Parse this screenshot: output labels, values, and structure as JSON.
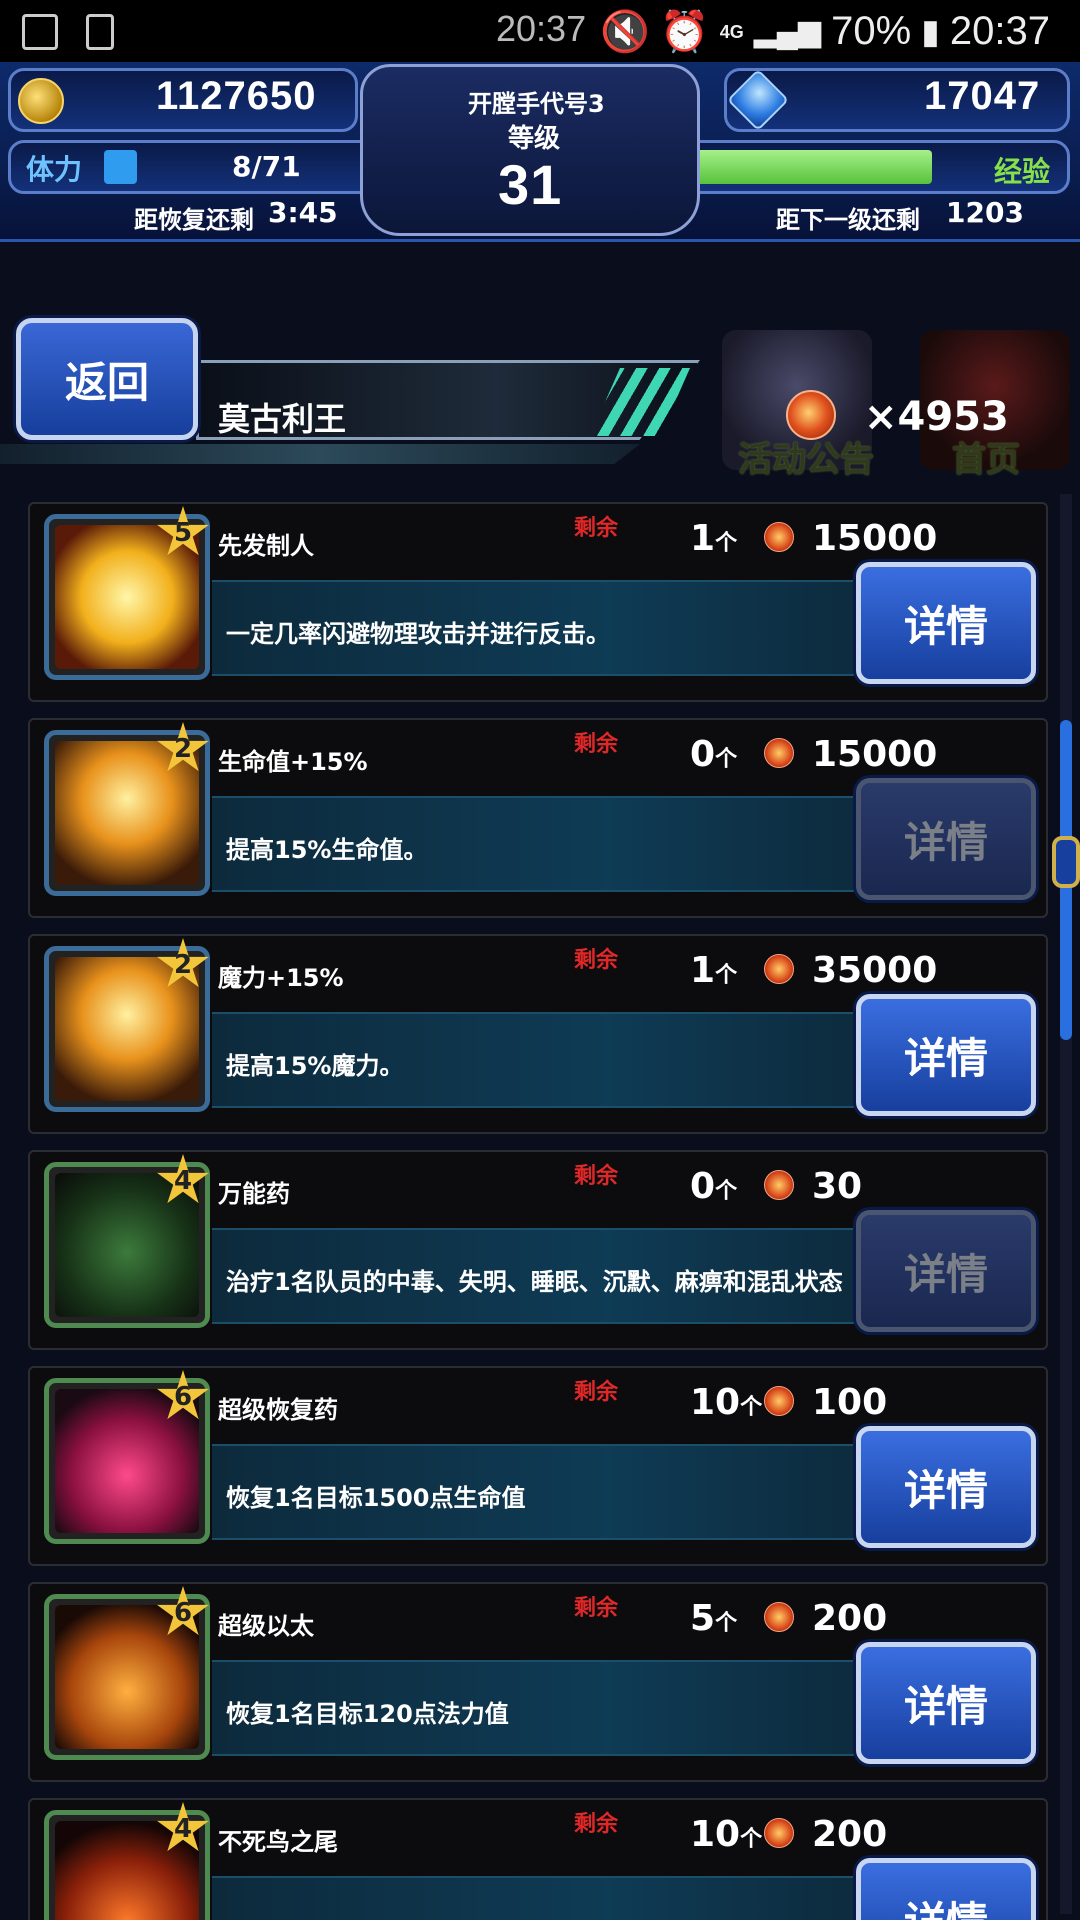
{
  "status_bar": {
    "time_center": "20:37",
    "network": "4G",
    "battery": "70%",
    "time_right": "20:37"
  },
  "hud": {
    "gil": "1127650",
    "player_name": "开膛手代号3",
    "level_label": "等级",
    "level": "31",
    "gems": "17047",
    "stamina_label": "体力",
    "stamina_value": "8/71",
    "recover_label": "距恢复还剩",
    "recover_time": "3:45",
    "exp_label": "经验",
    "next_level_label": "距下一级还剩",
    "next_level_value": "1203",
    "stamina_fill_fraction": 0.11,
    "exp_fill_fraction": 0.86
  },
  "header": {
    "back_label": "返回",
    "shop_title": "莫古利王",
    "events_label": "活动公告",
    "home_label": "首页",
    "currency_count": "×4953"
  },
  "items": [
    {
      "name": "先发制人",
      "stars": "5",
      "remain_label": "剩余",
      "qty": "1",
      "qty_unit": "个",
      "price": "15000",
      "desc": "一定几率闪避物理攻击并进行反击。",
      "detail_label": "详情",
      "detail_enabled": true,
      "icon": "fist-icon",
      "frame": "blue"
    },
    {
      "name": "生命值+15%",
      "stars": "2",
      "remain_label": "剩余",
      "qty": "0",
      "qty_unit": "个",
      "price": "15000",
      "desc": "提高15%生命值。",
      "detail_label": "详情",
      "detail_enabled": false,
      "icon": "hp-boost-icon",
      "frame": "blue"
    },
    {
      "name": "魔力+15%",
      "stars": "2",
      "remain_label": "剩余",
      "qty": "1",
      "qty_unit": "个",
      "price": "35000",
      "desc": "提高15%魔力。",
      "detail_label": "详情",
      "detail_enabled": true,
      "icon": "mp-boost-icon",
      "frame": "blue"
    },
    {
      "name": "万能药",
      "stars": "4",
      "remain_label": "剩余",
      "qty": "0",
      "qty_unit": "个",
      "price": "30",
      "desc": "治疗1名队员的中毒、失明、睡眠、沉默、麻痹和混乱状态",
      "detail_label": "详情",
      "detail_enabled": false,
      "icon": "remedy-bag-icon",
      "frame": "green"
    },
    {
      "name": "超级恢复药",
      "stars": "6",
      "remain_label": "剩余",
      "qty": "10",
      "qty_unit": "个",
      "price": "100",
      "desc": "恢复1名目标1500点生命值",
      "detail_label": "详情",
      "detail_enabled": true,
      "icon": "potion-icon",
      "frame": "green"
    },
    {
      "name": "超级以太",
      "stars": "6",
      "remain_label": "剩余",
      "qty": "5",
      "qty_unit": "个",
      "price": "200",
      "desc": "恢复1名目标120点法力值",
      "detail_label": "详情",
      "detail_enabled": true,
      "icon": "ether-icon",
      "frame": "green"
    },
    {
      "name": "不死鸟之尾",
      "stars": "4",
      "remain_label": "剩余",
      "qty": "10",
      "qty_unit": "个",
      "price": "200",
      "desc": "",
      "detail_label": "详情",
      "detail_enabled": true,
      "icon": "phoenix-down-icon",
      "frame": "green"
    }
  ]
}
